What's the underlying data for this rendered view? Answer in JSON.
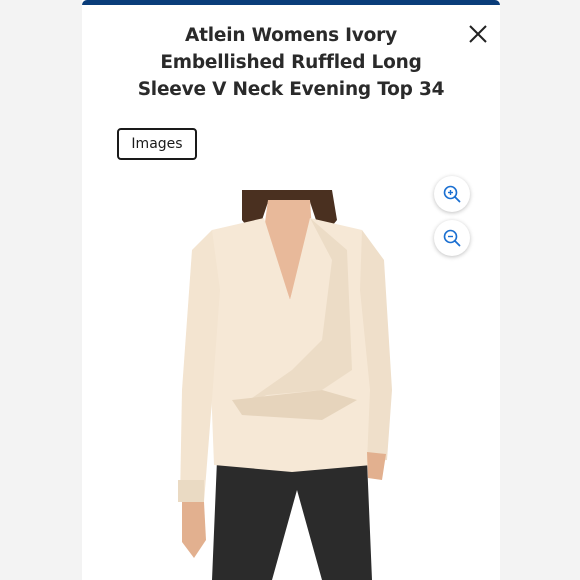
{
  "modal": {
    "title": "Atlein Womens Ivory Embellished Ruffled Long Sleeve V Neck Evening Top 34",
    "images_button_label": "Images",
    "close_icon": "close-icon",
    "zoom_in_icon": "zoom-in-icon",
    "zoom_out_icon": "zoom-out-icon"
  },
  "colors": {
    "header_bar": "#0a3d7a",
    "zoom_icon": "#1a6fd1",
    "blouse": "#f6e8d6",
    "pants": "#2b2b2b"
  }
}
